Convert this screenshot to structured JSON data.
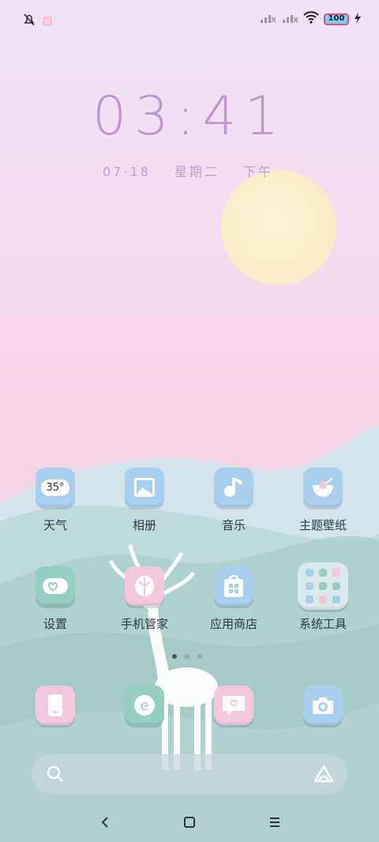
{
  "status_bar": {
    "battery_level": "100",
    "icons": [
      "mute-icon",
      "notification-icon",
      "signal-1-icon",
      "signal-2-icon",
      "wifi-icon",
      "battery-icon",
      "charging-icon"
    ]
  },
  "lockclock": {
    "time": "03:41",
    "date": "07·18",
    "weekday": "星期二",
    "period": "下午"
  },
  "apps": [
    {
      "label": "天气",
      "icon": "weather-icon",
      "badge": "35°",
      "color": "#a8d0ee"
    },
    {
      "label": "相册",
      "icon": "gallery-icon",
      "color": "#a8d0ee"
    },
    {
      "label": "音乐",
      "icon": "music-icon",
      "color": "#a8d0ee"
    },
    {
      "label": "主题壁纸",
      "icon": "theme-icon",
      "color": "#a8d0ee"
    },
    {
      "label": "设置",
      "icon": "settings-icon",
      "color": "#94cfc2"
    },
    {
      "label": "手机管家",
      "icon": "security-icon",
      "color": "#f4c8dc"
    },
    {
      "label": "应用商店",
      "icon": "app-store-icon",
      "color": "#a8d0ee"
    },
    {
      "label": "系统工具",
      "icon": "folder-icon",
      "color": "#dde8ea"
    }
  ],
  "dock": [
    {
      "icon": "phone-icon",
      "color": "#f4c8dc"
    },
    {
      "icon": "browser-icon",
      "color": "#94cfc2"
    },
    {
      "icon": "messages-icon",
      "color": "#f4c8dc"
    },
    {
      "icon": "camera-icon",
      "color": "#a8d0ee"
    }
  ],
  "page_indicator": {
    "pages": 3,
    "current": 1
  },
  "navigation": [
    "back-icon",
    "home-icon",
    "menu-icon"
  ]
}
